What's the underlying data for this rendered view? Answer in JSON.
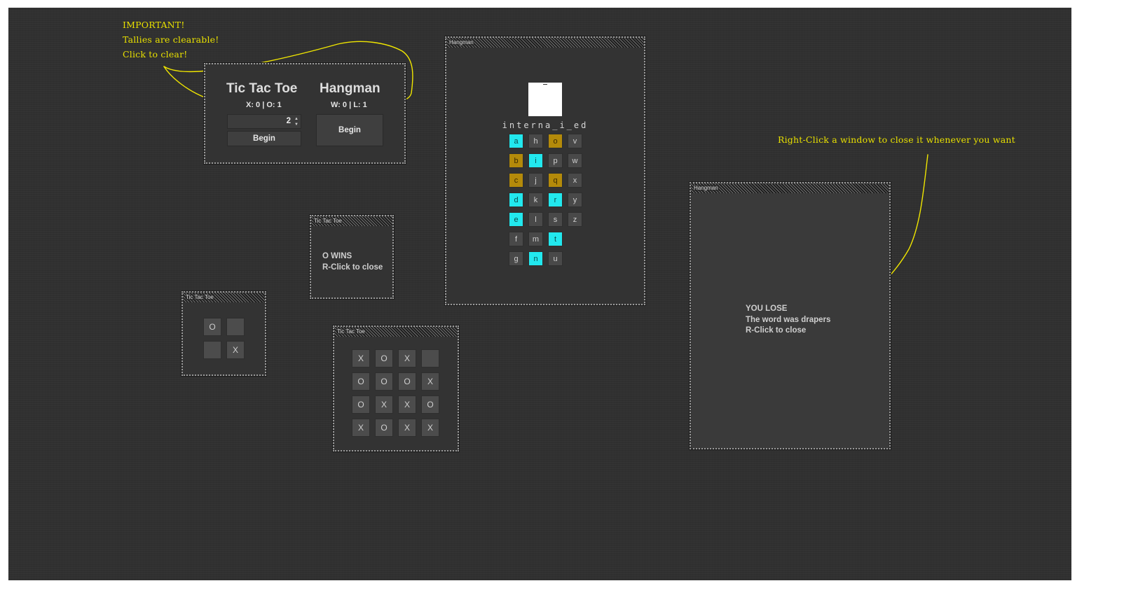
{
  "annotations": {
    "important": [
      "IMPORTANT!",
      "Tallies are clearable!",
      "Click to clear!"
    ],
    "right_click": "Right-Click a window to close it whenever you want"
  },
  "main_panel": {
    "ttt": {
      "title": "Tic Tac Toe",
      "tally": "X: 0 | O: 1",
      "size_value": "2",
      "begin_label": "Begin"
    },
    "hangman": {
      "title": "Hangman",
      "tally": "W: 0 | L: 1",
      "begin_label": "Begin"
    }
  },
  "windows": {
    "ttt_result": {
      "title": "Tic Tac Toe",
      "lines": [
        "O WINS",
        "R-Click to close"
      ]
    },
    "ttt_small": {
      "title": "Tic Tac Toe",
      "cells": [
        "O",
        "",
        "",
        "X"
      ]
    },
    "ttt_large": {
      "title": "Tic Tac Toe",
      "cells": [
        "X",
        "O",
        "X",
        "",
        "O",
        "O",
        "O",
        "X",
        "O",
        "X",
        "X",
        "O",
        "X",
        "O",
        "X",
        "X"
      ]
    },
    "hangman_game": {
      "title": "Hangman",
      "word": "interna_i_ed",
      "keys": [
        {
          "c": "a",
          "s": "hit"
        },
        {
          "c": "h",
          "s": ""
        },
        {
          "c": "o",
          "s": "miss"
        },
        {
          "c": "v",
          "s": ""
        },
        {
          "c": "b",
          "s": "miss"
        },
        {
          "c": "i",
          "s": "hit"
        },
        {
          "c": "p",
          "s": ""
        },
        {
          "c": "w",
          "s": ""
        },
        {
          "c": "c",
          "s": "miss"
        },
        {
          "c": "j",
          "s": ""
        },
        {
          "c": "q",
          "s": "miss"
        },
        {
          "c": "x",
          "s": ""
        },
        {
          "c": "d",
          "s": "hit"
        },
        {
          "c": "k",
          "s": ""
        },
        {
          "c": "r",
          "s": "hit"
        },
        {
          "c": "y",
          "s": ""
        },
        {
          "c": "e",
          "s": "hit"
        },
        {
          "c": "l",
          "s": ""
        },
        {
          "c": "s",
          "s": ""
        },
        {
          "c": "z",
          "s": ""
        },
        {
          "c": "f",
          "s": ""
        },
        {
          "c": "m",
          "s": ""
        },
        {
          "c": "t",
          "s": "hit"
        },
        {
          "c": "g",
          "s": ""
        },
        {
          "c": "n",
          "s": "hit"
        },
        {
          "c": "u",
          "s": ""
        }
      ]
    },
    "hangman_result": {
      "title": "Hangman",
      "lines": [
        "YOU LOSE",
        "The word was drapers",
        "R-Click to close"
      ]
    }
  },
  "colors": {
    "accent_yellow": "#e8e000",
    "hit": "#22e8ee",
    "miss": "#b48a0a",
    "background": "#303030"
  }
}
